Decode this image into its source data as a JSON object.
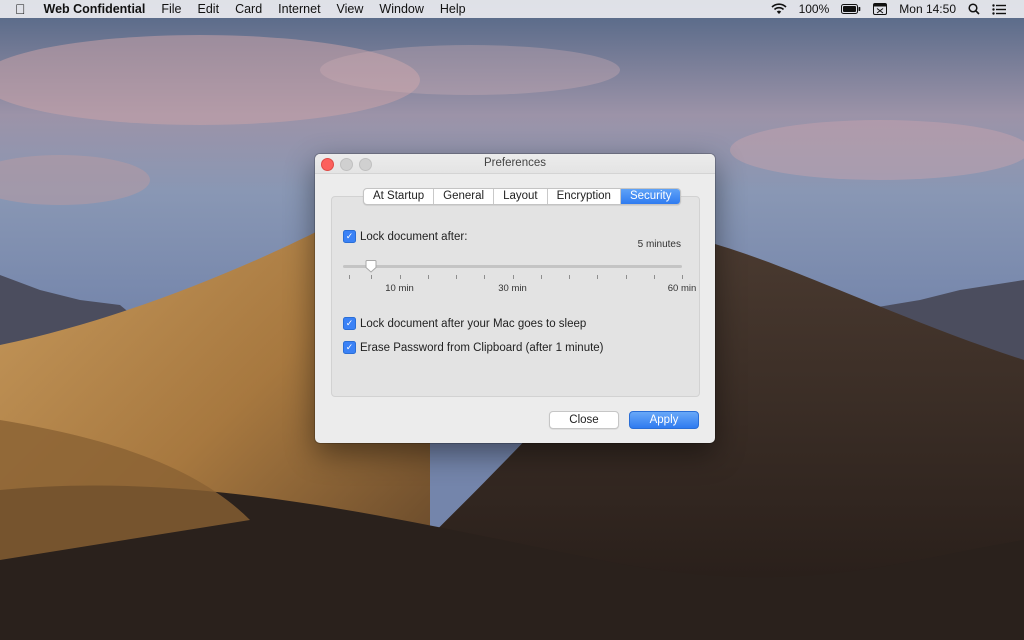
{
  "menubar": {
    "apple_icon": "apple-logo",
    "app_name": "Web Confidential",
    "items": [
      "File",
      "Edit",
      "Card",
      "Internet",
      "View",
      "Window",
      "Help"
    ],
    "battery": "100%",
    "clock": "Mon 14:50"
  },
  "window": {
    "title": "Preferences",
    "tabs": [
      "At Startup",
      "General",
      "Layout",
      "Encryption",
      "Security"
    ],
    "active_tab": "Security",
    "lock_after": {
      "label": "Lock document after:",
      "checked": true,
      "value_label": "5 minutes"
    },
    "slider": {
      "min_minutes": 1,
      "max_minutes": 60,
      "value_minutes": 5,
      "tick_labels": [
        "10 min",
        "30 min",
        "60 min"
      ]
    },
    "lock_on_sleep": {
      "label": "Lock document after your Mac goes to sleep",
      "checked": true
    },
    "erase_clipboard": {
      "label": "Erase Password from Clipboard (after 1 minute)",
      "checked": true
    },
    "buttons": {
      "close": "Close",
      "apply": "Apply"
    }
  },
  "colors": {
    "accent": "#2f7bf0",
    "close_light": "#fc605c"
  }
}
